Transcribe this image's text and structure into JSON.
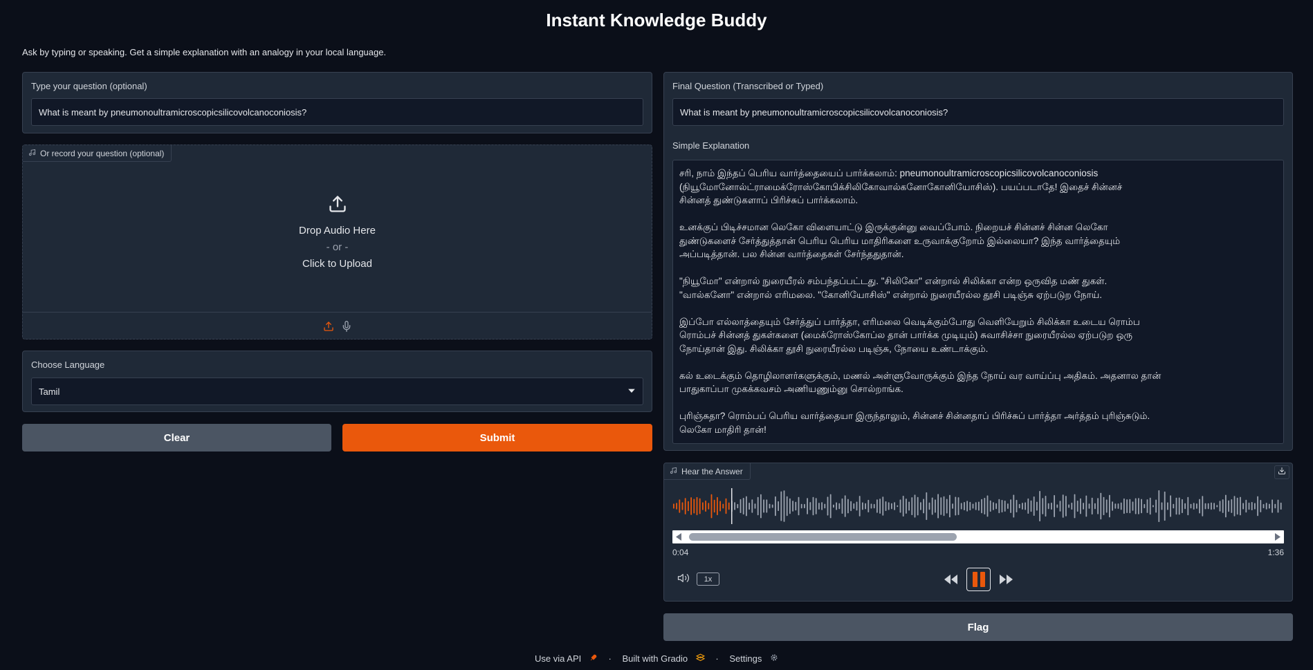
{
  "app": {
    "title": "Instant Knowledge Buddy",
    "subtitle": "Ask by typing or speaking. Get a simple explanation with an analogy in your local language."
  },
  "question_input": {
    "label": "Type your question (optional)",
    "value": "What is meant by pneumonoultramicroscopicsilicovolcanoconiosis?"
  },
  "audio_input": {
    "tag_label": "Or record your question (optional)",
    "drop_text": "Drop Audio Here",
    "or_text": "- or -",
    "click_text": "Click to Upload"
  },
  "language": {
    "label": "Choose Language",
    "selected": "Tamil"
  },
  "buttons": {
    "clear": "Clear",
    "submit": "Submit",
    "flag": "Flag"
  },
  "final_question": {
    "label": "Final Question (Transcribed or Typed)",
    "value": "What is meant by pneumonoultramicroscopicsilicovolcanoconiosis?"
  },
  "explanation": {
    "label": "Simple Explanation",
    "lines": [
      "சரி, நாம் இந்தப் பெரிய வார்த்தையைப் பார்க்கலாம்: pneumonoultramicroscopicsilicovolcanoconiosis",
      "(நியூமோனோல்ட்ராமைக்ரோஸ்கோபிக்சிலிகோவால்கனோகோனியோசிஸ்). பயப்படாதே! இதைச் சின்னச்",
      "சின்னத் துண்டுகளாப் பிரிச்சுப் பார்க்கலாம்.",
      "",
      "உனக்குப் பிடிச்சமான லெகோ விளையாட்டு இருக்குன்னு வைப்போம். நிறையச் சின்னச் சின்ன லெகோ",
      "துண்டுகளைச் சேர்த்துத்தான் பெரிய பெரிய மாதிரிகளை உருவாக்குறோம் இல்லையா? இந்த வார்த்தையும்",
      "அப்படித்தான். பல சின்ன வார்த்தைகள் சேர்ந்ததுதான்.",
      "",
      "\"நியூமோ\" என்றால் நுரையீரல் சம்பந்தப்பட்டது. \"சிலிகோ\" என்றால் சிலிக்கா என்ற ஒருவித மண் துகள்.",
      "\"வால்கனோ\" என்றால் எரிமலை. \"கோனியோசிஸ்\" என்றால் நுரையீரல்ல தூசி படிஞ்சு ஏற்படுற நோய்.",
      "",
      "இப்போ எல்லாத்தையும் சேர்த்துப் பார்த்தா, எரிமலை வெடிக்கும்போது வெளியேறும் சிலிக்கா உடைய ரொம்ப",
      "ரொம்பச் சின்னத் துகள்களை (மைக்ரோஸ்கோப்ல தான் பார்க்க முடியும்) சுவாசிச்சா நுரையீரல்ல ஏற்படுற ஒரு",
      "நோய்தான் இது. சிலிக்கா தூசி நுரையீரல்ல படிஞ்சு, நோயை உண்டாக்கும்.",
      "",
      "கல் உடைக்கும் தொழிலாளர்களுக்கும், மணல் அள்ளுவோருக்கும் இந்த நோய் வர வாய்ப்பு அதிகம். அதனால தான்",
      "பாதுகாப்பா முகக்கவசம் அணியணும்னு சொல்றாங்க.",
      "",
      "புரிஞ்சுதா? ரொம்பப் பெரிய வார்த்தையா இருந்தாலும், சின்னச் சின்னதாப் பிரிச்சுப் பார்த்தா அர்த்தம் புரிஞ்சுடும்.",
      "லெகோ மாதிரி தான்!"
    ]
  },
  "audio_output": {
    "tag_label": "Hear the Answer",
    "current_time": "0:04",
    "total_time": "1:36",
    "speed": "1x",
    "progress": 0.042
  },
  "footer": {
    "api": "Use via API",
    "built": "Built with Gradio",
    "settings": "Settings",
    "sep": "·"
  },
  "colors": {
    "accent": "#ea580c",
    "background": "#0b0f19",
    "panel": "#1f2937",
    "input": "#111827",
    "secondary_button": "#4b5563",
    "waveform_played": "#ea580c",
    "waveform_unplayed": "#9ca3af"
  },
  "icons": {
    "music": "music-note-icon",
    "upload": "upload-icon",
    "mic": "microphone-icon",
    "dropdown": "chevron-down-icon",
    "download": "download-icon",
    "volume": "volume-icon",
    "rewind": "rewind-icon",
    "pause": "pause-icon",
    "forward": "fast-forward-icon",
    "gradio": "gradio-logo-icon",
    "settings": "gear-icon",
    "api": "rocket-icon"
  }
}
